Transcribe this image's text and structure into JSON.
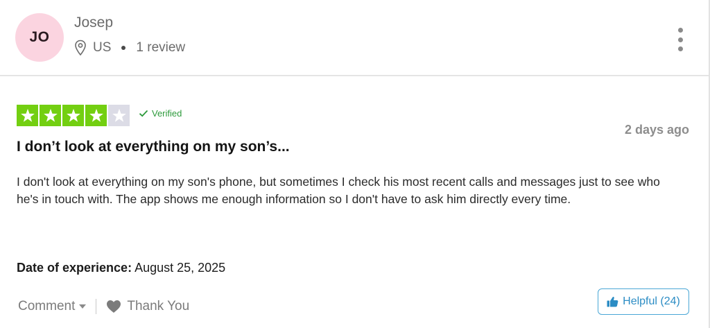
{
  "reviewer": {
    "initials": "JO",
    "name": "Josep",
    "country": "US",
    "review_count": "1 review",
    "avatar_color": "#fbd4e0"
  },
  "review": {
    "rating": 4,
    "max_rating": 5,
    "star_color": "#73cf11",
    "verified_label": "Verified",
    "time_ago": "2 days ago",
    "title": "I don’t look at everything on my son’s...",
    "body": "I don't look at everything on my son's phone, but sometimes I check his most recent calls and messages just to see who he's in touch with. The app shows me enough information so I don't have to ask him directly every time.",
    "experience_label": "Date of experience:",
    "experience_date": "August 25, 2025"
  },
  "actions": {
    "comment_label": "Comment",
    "thank_label": "Thank You",
    "helpful_label": "Helpful (24)",
    "helpful_color": "#2b8cc4"
  },
  "icons": {
    "location": "map-pin-icon",
    "more": "kebab-menu-icon",
    "verified": "check-icon",
    "thank": "heart-icon",
    "helpful": "thumbs-up-icon"
  }
}
